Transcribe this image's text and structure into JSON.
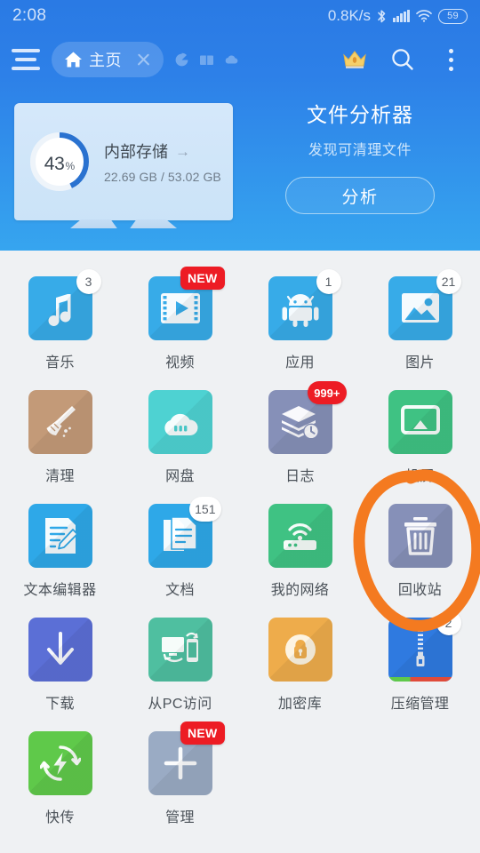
{
  "status_bar": {
    "time": "2:08",
    "net_speed": "0.8K/s",
    "bluetooth_icon": "bluetooth-icon",
    "signal_icon": "cellular-signal-icon",
    "wifi_icon": "wifi-icon",
    "battery_level": "59"
  },
  "toolbar": {
    "menu_icon": "hamburger-menu-icon",
    "active_tab": {
      "icon": "home-icon",
      "label": "主页",
      "close_icon": "close-icon"
    },
    "ghost_tabs": [
      {
        "icon": "pie-chart-icon"
      },
      {
        "icon": "book-icon"
      },
      {
        "icon": "cloud-icon"
      }
    ],
    "premium_icon": "crown-icon",
    "search_icon": "search-icon",
    "overflow_icon": "more-vertical-icon"
  },
  "storage_card": {
    "percent_value": "43",
    "percent_symbol": "%",
    "title": "内部存储",
    "arrow_icon": "arrow-right-icon",
    "usage": "22.69 GB / 53.02 GB",
    "ring_percent": 43,
    "ring_color": "#2a72d0",
    "ring_track": "#ffffff"
  },
  "analyzer": {
    "title": "文件分析器",
    "subtitle": "发现可清理文件",
    "button_label": "分析"
  },
  "colors": {
    "header_top": "#2a7ae4",
    "header_bottom": "#36a5ef",
    "grid_background": "#eff1f3",
    "annotation": "#f47a20",
    "badge_red": "#ed1c24"
  },
  "annotation": {
    "shape": "hand-drawn-circle",
    "color": "#f47a20",
    "targets": "回收站"
  },
  "apps": [
    {
      "label": "音乐",
      "icon": "music-note-icon",
      "tile_color": "#37abe8",
      "badge": "3",
      "badge_type": "count"
    },
    {
      "label": "视频",
      "icon": "video-player-icon",
      "tile_color": "#37abe8",
      "badge": "NEW",
      "badge_type": "new"
    },
    {
      "label": "应用",
      "icon": "android-icon",
      "tile_color": "#37abe8",
      "badge": "1",
      "badge_type": "count"
    },
    {
      "label": "图片",
      "icon": "image-icon",
      "tile_color": "#37abe8",
      "badge": "21",
      "badge_type": "count"
    },
    {
      "label": "清理",
      "icon": "broom-icon",
      "tile_color": "#c39a78",
      "badge": "",
      "badge_type": "none"
    },
    {
      "label": "网盘",
      "icon": "cloud-drive-icon",
      "tile_color": "#4ed2d2",
      "badge": "",
      "badge_type": "none"
    },
    {
      "label": "日志",
      "icon": "log-stack-icon",
      "tile_color": "#8690b8",
      "badge": "999+",
      "badge_type": "red"
    },
    {
      "label": "投屏",
      "icon": "cast-screen-icon",
      "tile_color": "#3fc283",
      "badge": "",
      "badge_type": "none"
    },
    {
      "label": "文本编辑器",
      "icon": "text-editor-icon",
      "tile_color": "#2ea8e8",
      "badge": "",
      "badge_type": "none"
    },
    {
      "label": "文档",
      "icon": "document-icon",
      "tile_color": "#2ea8e8",
      "badge": "151",
      "badge_type": "count"
    },
    {
      "label": "我的网络",
      "icon": "router-wifi-icon",
      "tile_color": "#3fc283",
      "badge": "",
      "badge_type": "none"
    },
    {
      "label": "回收站",
      "icon": "trash-bin-icon",
      "tile_color": "#8690b8",
      "badge": "",
      "badge_type": "none"
    },
    {
      "label": "下载",
      "icon": "download-arrow-icon",
      "tile_color": "#5b6fd6",
      "badge": "",
      "badge_type": "none"
    },
    {
      "label": "从PC访问",
      "icon": "pc-to-phone-icon",
      "tile_color": "#4fbfa0",
      "badge": "",
      "badge_type": "none"
    },
    {
      "label": "加密库",
      "icon": "lock-vault-icon",
      "tile_color": "#eeac4b",
      "badge": "",
      "badge_type": "none"
    },
    {
      "label": "压缩管理",
      "icon": "zip-archive-icon",
      "tile_color": "#2f7ae0",
      "badge": "2",
      "badge_type": "count"
    },
    {
      "label": "快传",
      "icon": "fast-transfer-icon",
      "tile_color": "#5fc94a",
      "badge": "",
      "badge_type": "none"
    },
    {
      "label": "管理",
      "icon": "add-plus-icon",
      "tile_color": "#9aabc4",
      "badge": "NEW",
      "badge_type": "new"
    }
  ]
}
